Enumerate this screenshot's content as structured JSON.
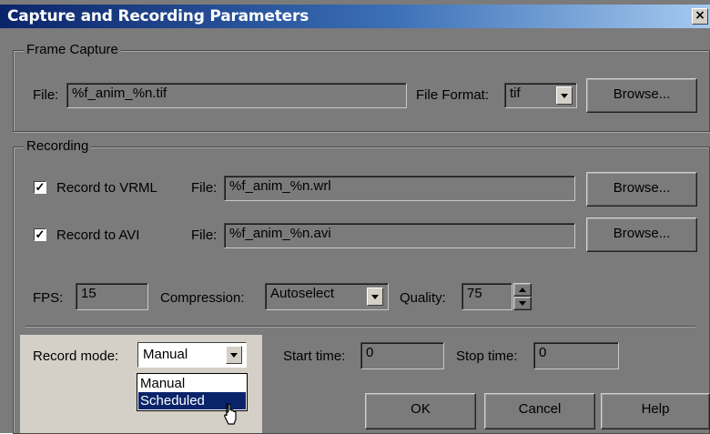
{
  "window": {
    "title": "Capture and Recording Parameters",
    "close_label": "×"
  },
  "frame_capture": {
    "legend": "Frame Capture",
    "file_label": "File:",
    "file_value": "%f_anim_%n.tif",
    "format_label": "File Format:",
    "format_value": "tif",
    "browse_label": "Browse..."
  },
  "recording": {
    "legend": "Recording",
    "vrml": {
      "checked": true,
      "label": "Record to VRML",
      "file_label": "File:",
      "file_value": "%f_anim_%n.wrl",
      "browse_label": "Browse..."
    },
    "avi": {
      "checked": true,
      "label": "Record to AVI",
      "file_label": "File:",
      "file_value": "%f_anim_%n.avi",
      "browse_label": "Browse..."
    },
    "fps_label": "FPS:",
    "fps_value": "15",
    "compression_label": "Compression:",
    "compression_value": "Autoselect",
    "quality_label": "Quality:",
    "quality_value": "75",
    "record_mode_label": "Record mode:",
    "record_mode_value": "Manual",
    "record_mode_options": [
      "Manual",
      "Scheduled"
    ],
    "highlighted_option": "Scheduled",
    "start_time_label": "Start time:",
    "start_time_value": "0",
    "stop_time_label": "Stop time:",
    "stop_time_value": "0"
  },
  "buttons": {
    "ok": "OK",
    "cancel": "Cancel",
    "help": "Help"
  },
  "colors": {
    "dialog_bg": "#7b7b7b",
    "title_start": "#0a246a",
    "title_end": "#a6caf0",
    "highlight": "#0a246a"
  }
}
